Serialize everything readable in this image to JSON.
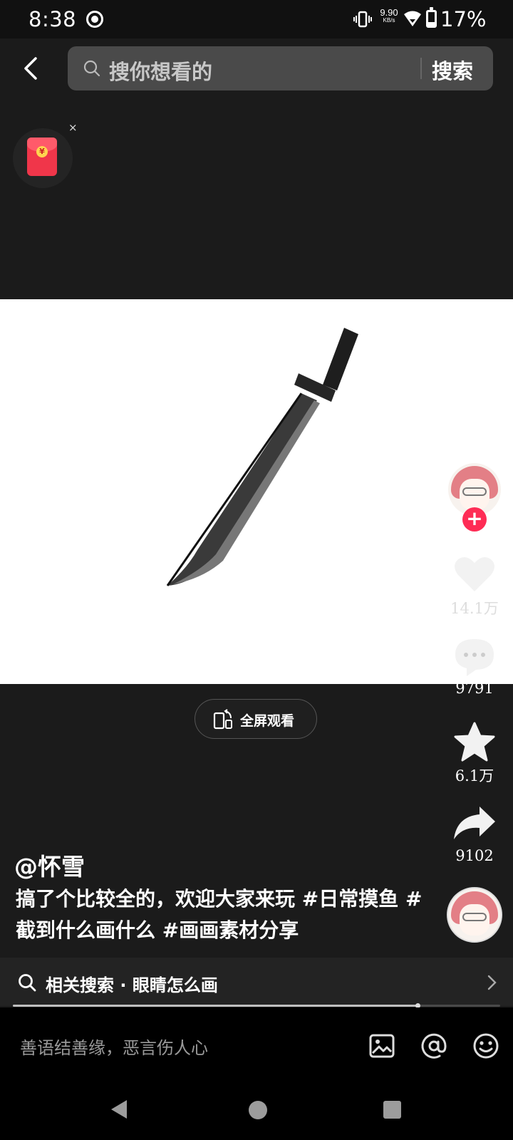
{
  "status_bar": {
    "time": "8:38",
    "net_speed_value": "9.90",
    "net_speed_unit": "KB/s",
    "battery": "17%"
  },
  "search": {
    "placeholder": "搜你想看的",
    "button_label": "搜索"
  },
  "red_packet": {
    "close_label": "×"
  },
  "video": {
    "fullscreen_label": "全屏观看"
  },
  "actions": {
    "likes": "14.1万",
    "comments": "9791",
    "favorites": "6.1万",
    "shares": "9102",
    "follow_symbol": "+"
  },
  "post": {
    "author": "@怀雪",
    "caption": "搞了个比较全的，欢迎大家来玩 #日常摸鱼 #截到什么画什么 #画画素材分享"
  },
  "related_search": {
    "label": "相关搜索 · 眼睛怎么画"
  },
  "playback": {
    "progress": 0.83
  },
  "comment_bar": {
    "placeholder": "善语结善缘，恶言伤人心"
  },
  "colors": {
    "background": "#1b1b1b",
    "accent_red": "#fe2c55",
    "video_bg": "#ffffff"
  },
  "icons": {
    "back": "chevron-left-icon",
    "search": "search-icon",
    "like": "heart-icon",
    "comment": "comment-bubble-icon",
    "favorite": "star-icon",
    "share": "share-arrow-icon",
    "image": "image-icon",
    "mention": "at-icon",
    "emoji": "emoji-icon"
  }
}
